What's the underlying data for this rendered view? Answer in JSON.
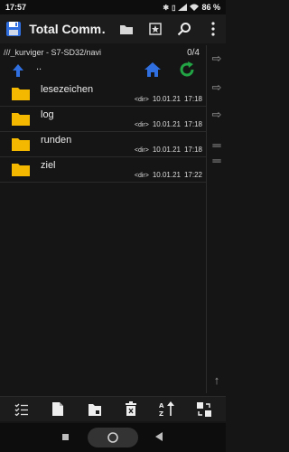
{
  "status_bar": {
    "time": "17:57",
    "battery": "86 %",
    "icons": [
      "bluetooth-icon",
      "vibrate-icon",
      "signal-icon",
      "wifi-icon",
      "battery-icon"
    ]
  },
  "app_bar": {
    "title": "Total Comm…",
    "actions": [
      "folder-icon",
      "bookmark-icon",
      "search-icon",
      "more-icon"
    ]
  },
  "path": {
    "text": "///_kurviger - S7-SD32/navi",
    "count": "0/4"
  },
  "parent": {
    "label": ".."
  },
  "files": [
    {
      "name": "lesezeichen",
      "type": "<dir>",
      "date": "10.01.21",
      "time": "17:18"
    },
    {
      "name": "log",
      "type": "<dir>",
      "date": "10.01.21",
      "time": "17:18"
    },
    {
      "name": "runden",
      "type": "<dir>",
      "date": "10.01.21",
      "time": "17:18"
    },
    {
      "name": "ziel",
      "type": "<dir>",
      "date": "10.01.21",
      "time": "17:22"
    }
  ],
  "colors": {
    "folder": "#f5b800",
    "up_arrow": "#2f6fe0",
    "home": "#2f6fe0",
    "refresh": "#22a444",
    "background": "#151515"
  },
  "toolbar": {
    "buttons": [
      "select-list-icon",
      "new-file-icon",
      "new-folder-icon",
      "delete-icon",
      "sort-icon",
      "swap-panels-icon"
    ]
  }
}
